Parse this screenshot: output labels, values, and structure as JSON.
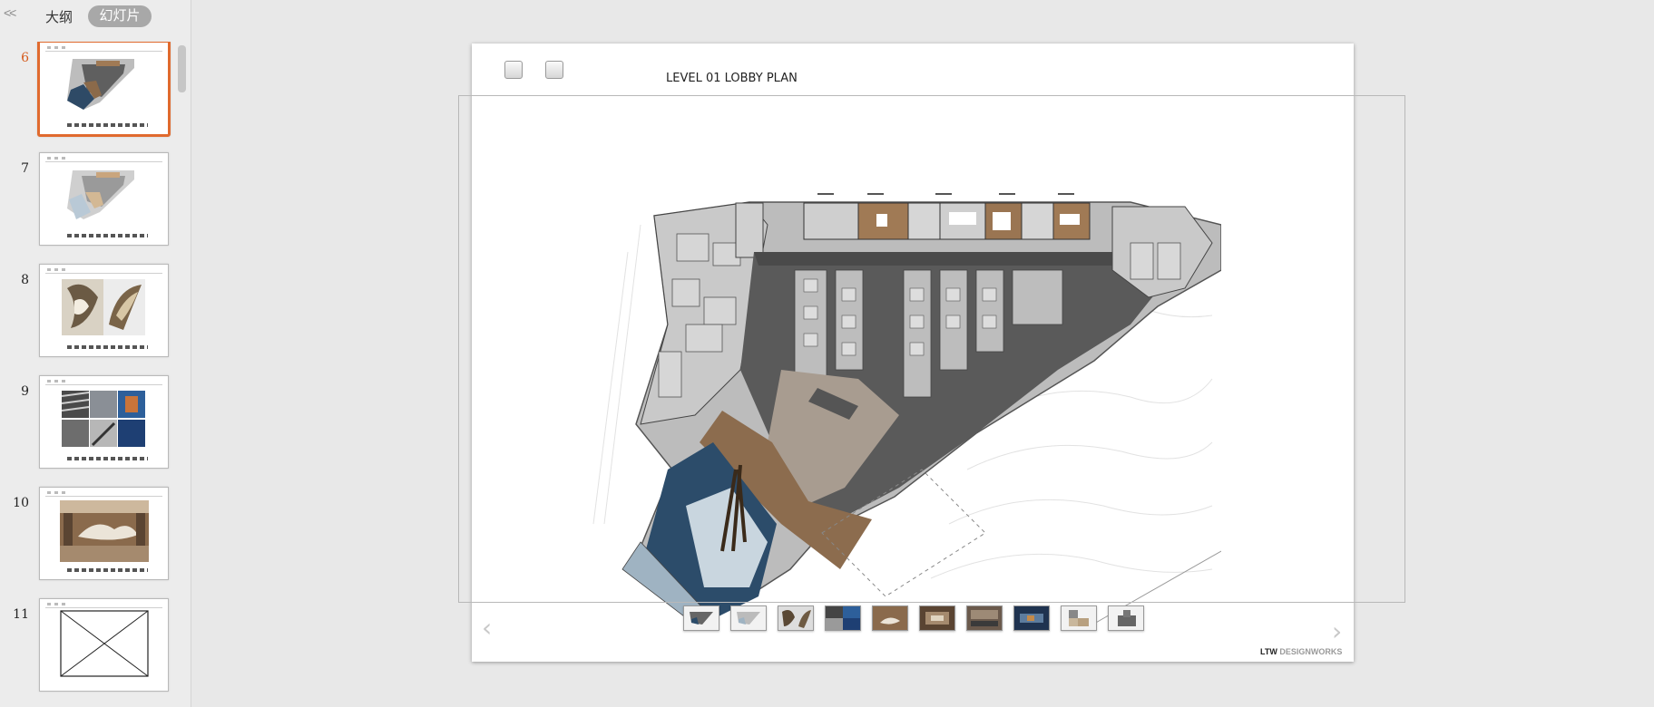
{
  "sidebar": {
    "collapse_glyph": "<<",
    "tabs": {
      "outline": "大纲",
      "slides": "幻灯片"
    },
    "thumbnails": [
      {
        "number": "6",
        "kind": "floorplan"
      },
      {
        "number": "7",
        "kind": "floorplan-alt"
      },
      {
        "number": "8",
        "kind": "sculpture"
      },
      {
        "number": "9",
        "kind": "facade-grid"
      },
      {
        "number": "10",
        "kind": "lobby-render"
      },
      {
        "number": "11",
        "kind": "placeholder"
      }
    ]
  },
  "slide": {
    "title": "LEVEL 01 LOBBY PLAN",
    "brand_bold": "LTW",
    "brand_light": "DESIGNWORKS",
    "prev_glyph": "‹",
    "next_glyph": "›"
  },
  "colors": {
    "accent": "#e06a2e",
    "active_number": "#d55a1b",
    "tab_pill": "#a8a8a8"
  }
}
